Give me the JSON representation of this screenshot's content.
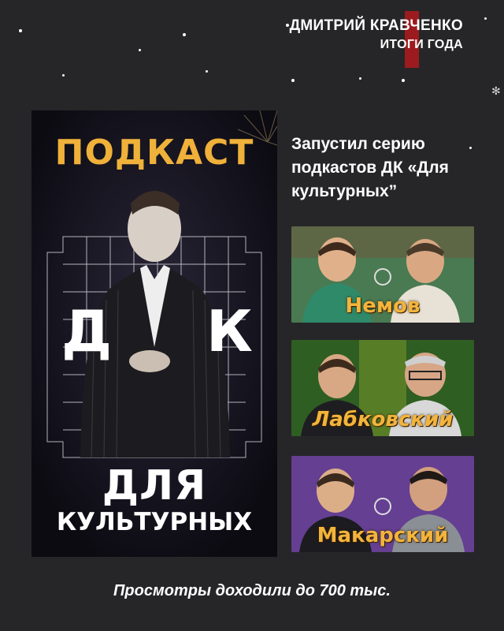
{
  "header": {
    "name": "ДМИТРИЙ КРАВЧЕНКО",
    "subtitle": "ИТОГИ ГОДА",
    "accent_color": "#9c1b1e"
  },
  "poster": {
    "word_top": "ПОДКАСТ",
    "letter_left": "Д",
    "letter_right": "К",
    "word_mid": "ДЛЯ",
    "word_bottom": "КУЛЬТУРНЫХ",
    "title_color": "#f0b13a"
  },
  "description": "Запустил серию подкастов ДК «Для культурных”",
  "episodes": [
    {
      "label": "Немов",
      "background": "#3a6e45"
    },
    {
      "label": "Лабковский",
      "background": "#2d5a24"
    },
    {
      "label": "Макарский",
      "background": "#5b3a86"
    }
  ],
  "footer": "Просмотры доходили до 700 тыс.",
  "decor": {
    "icon": "snowflake-icon"
  }
}
